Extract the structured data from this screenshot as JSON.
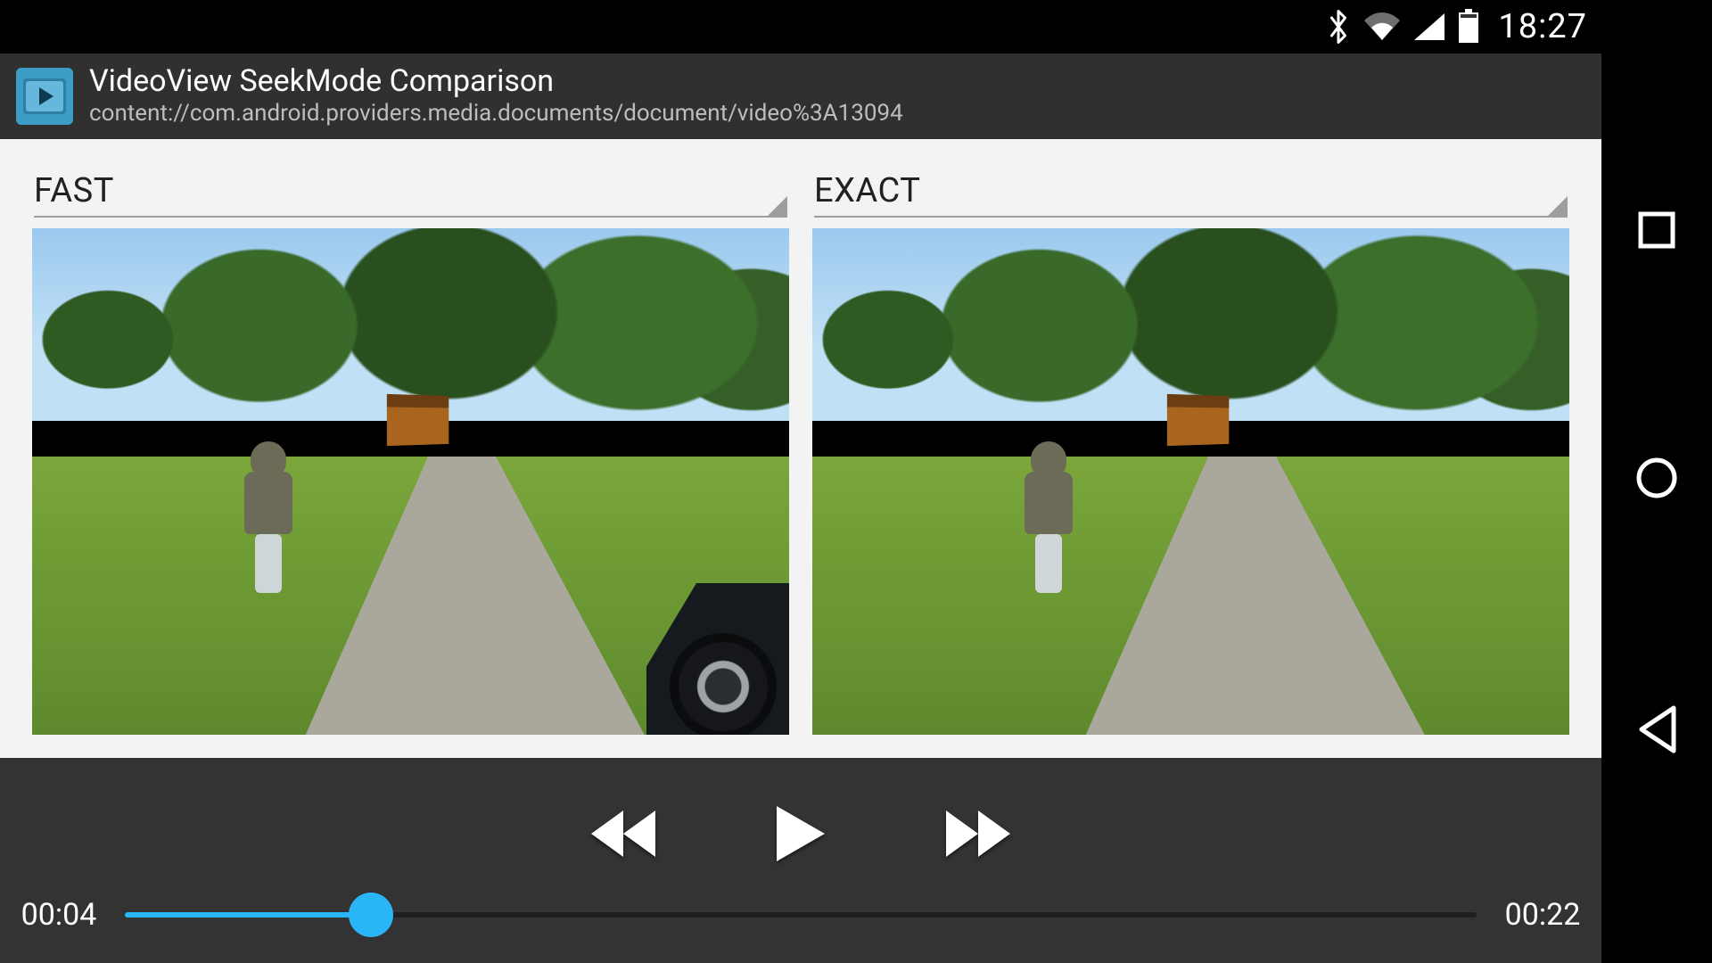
{
  "status": {
    "time": "18:27",
    "bluetooth": true,
    "wifi_level": 2,
    "cell_level": 4,
    "battery_pct": 90
  },
  "app": {
    "title": "VideoView SeekMode Comparison",
    "subtitle": "content://com.android.providers.media.documents/document/video%3A13094"
  },
  "panels": {
    "left": {
      "mode_label": "FAST"
    },
    "right": {
      "mode_label": "EXACT"
    }
  },
  "playback": {
    "elapsed": "00:04",
    "duration": "00:22",
    "elapsed_seconds": 4,
    "duration_seconds": 22
  },
  "colors": {
    "accent": "#29b6f6",
    "toolbar": "#303030",
    "controller": "#333333"
  }
}
